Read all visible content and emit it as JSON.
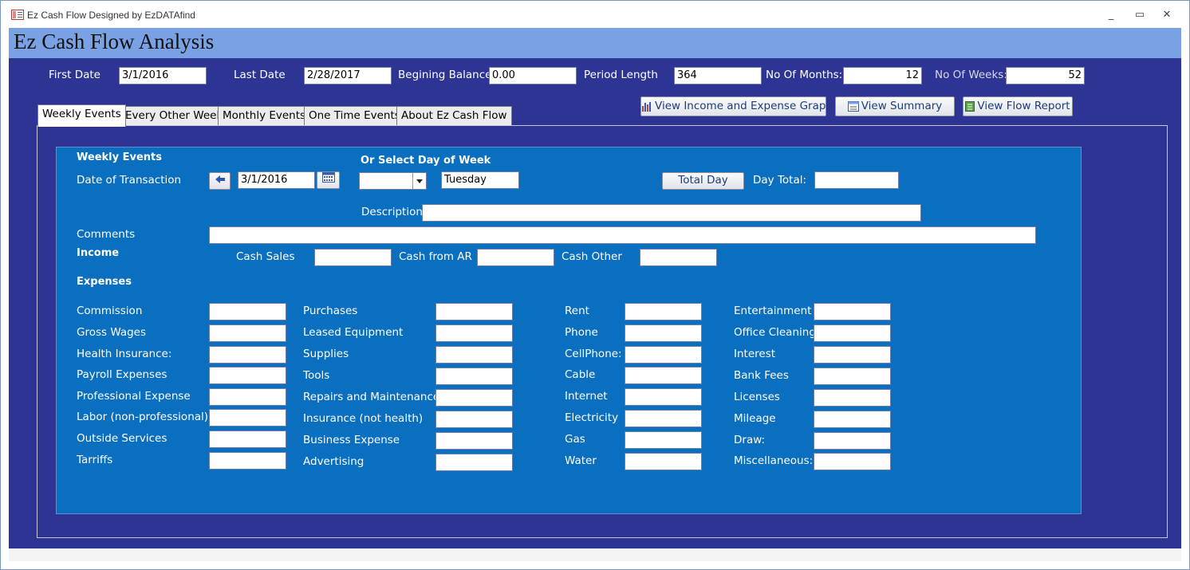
{
  "window": {
    "title": "Ez Cash Flow Designed by EzDATAfind",
    "min_glyph": "_",
    "max_glyph": "▭",
    "close_glyph": "✕"
  },
  "header": {
    "title": "Ez Cash Flow Analysis"
  },
  "summary": {
    "first_date_label": "First Date",
    "first_date": "3/1/2016",
    "last_date_label": "Last Date",
    "last_date": "2/28/2017",
    "begin_balance_label": "Begining Balance",
    "begin_balance": "0.00",
    "period_length_label": "Period Length",
    "period_length": "364",
    "months_label": "No Of Months:",
    "months": "12",
    "weeks_label": "No Of Weeks:",
    "weeks": "52"
  },
  "buttons": {
    "graph": "View Income and Expense Graph",
    "summary": "View Summary",
    "flow_report": "View Flow Report"
  },
  "tabs": [
    {
      "label": "Weekly Events"
    },
    {
      "label": "Every Other Week"
    },
    {
      "label": "Monthly Events"
    },
    {
      "label": "One Time Events"
    },
    {
      "label": "About Ez Cash Flow"
    }
  ],
  "form": {
    "section_title": "Weekly Events",
    "date_label": "Date of Transaction",
    "date_value": "3/1/2016",
    "dow_label": "Or Select Day of Week",
    "dow_select": "",
    "day_name": "Tuesday",
    "total_day_button": "Total Day",
    "day_total_label": "Day Total:",
    "day_total": "",
    "description_label": "Description",
    "description": "",
    "comments_label": "Comments",
    "comments": "",
    "income_label": "Income",
    "income": {
      "cash_sales": "Cash Sales",
      "cash_ar": "Cash from AR",
      "cash_other": "Cash Other"
    },
    "expenses_label": "Expenses",
    "expenses": {
      "col1": [
        "Commission",
        "Gross Wages",
        "Health Insurance:",
        "Payroll Expenses",
        "Professional Expense",
        "Labor (non-professional)",
        "Outside Services",
        "Tarriffs"
      ],
      "col2": [
        "Purchases",
        "Leased Equipment",
        "Supplies",
        "Tools",
        "Repairs and Maintenance",
        "Insurance (not health)",
        "Business Expense",
        "Advertising"
      ],
      "col3": [
        "Rent",
        "Phone",
        "CellPhone:",
        "Cable",
        "Internet",
        "Electricity",
        "Gas",
        "Water"
      ],
      "col4": [
        "Entertainment",
        "Office Cleaning",
        "Interest",
        "Bank Fees",
        "Licenses",
        "Mileage",
        "Draw:",
        "Miscellaneous:"
      ]
    }
  },
  "colors": {
    "header_band": "#7aa1e3",
    "main_bg": "#2e3494",
    "panel_bg": "#0b6fbf"
  }
}
